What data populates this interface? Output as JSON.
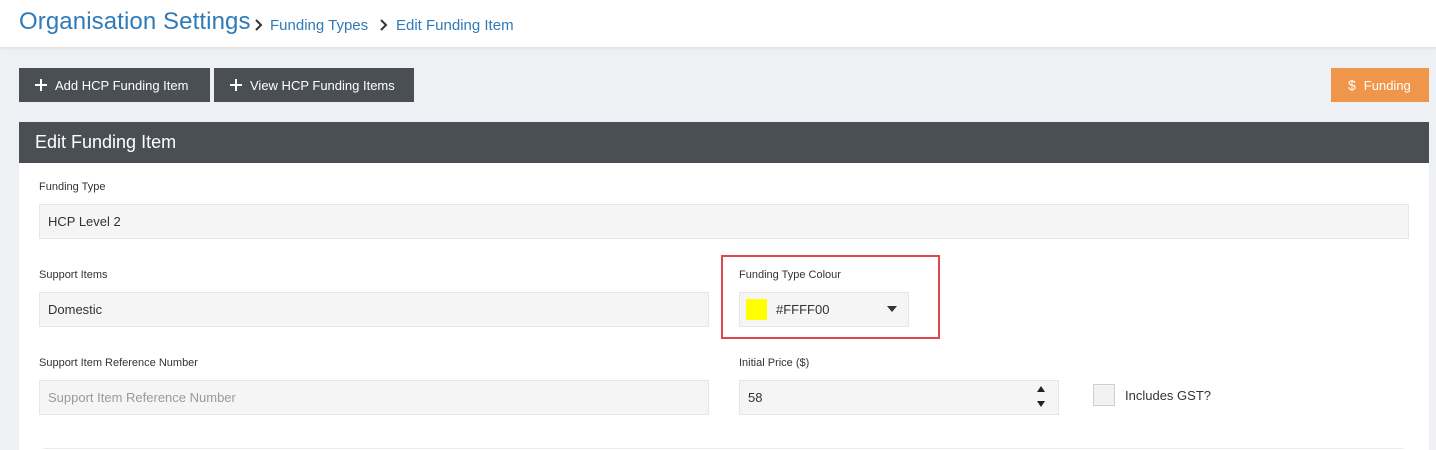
{
  "header": {
    "title": "Organisation Settings",
    "breadcrumbs": [
      "Funding Types",
      "Edit Funding Item"
    ]
  },
  "toolbar": {
    "add_label": "Add HCP Funding Item",
    "view_label": "View HCP Funding Items",
    "funding_label": "Funding"
  },
  "panel": {
    "title": "Edit Funding Item"
  },
  "form": {
    "funding_type": {
      "label": "Funding Type",
      "value": "HCP Level 2"
    },
    "support_items": {
      "label": "Support Items",
      "value": "Domestic"
    },
    "funding_type_colour": {
      "label": "Funding Type Colour",
      "value": "#FFFF00",
      "swatch_color": "#ffff00"
    },
    "support_item_ref": {
      "label": "Support Item Reference Number",
      "value": "",
      "placeholder": "Support Item Reference Number"
    },
    "initial_price": {
      "label": "Initial Price ($)",
      "value": "58"
    },
    "includes_gst": {
      "label": "Includes GST?",
      "checked": false
    }
  },
  "colors": {
    "accent_blue": "#2f7ab9",
    "dark_button": "#4a4e55",
    "orange_button": "#f0964b",
    "highlight_border": "#e0474c"
  }
}
